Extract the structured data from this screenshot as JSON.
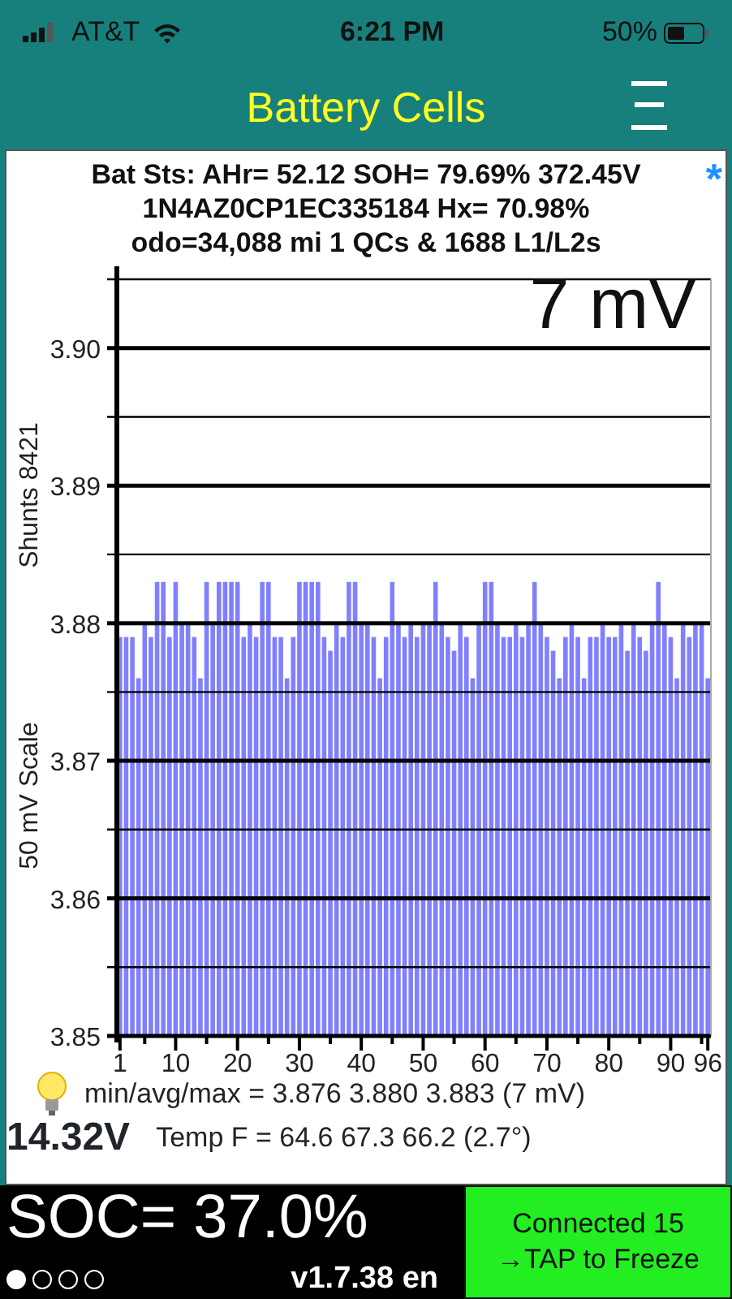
{
  "status_bar": {
    "carrier": "AT&T",
    "time": "6:21 PM",
    "battery": "50%"
  },
  "header": {
    "title": "Battery Cells"
  },
  "summary": {
    "lines": [
      "Bat Sts: AHr= 52.12 SOH= 79.69% 372.45V",
      "1N4AZ0CP1EC335184  Hx= 70.98%",
      "odo=34,088 mi 1 QCs & 1688 L1/L2s"
    ],
    "marker": "*"
  },
  "chart": {
    "spread_label": "7 mV",
    "shunts_label": "Shunts 8421",
    "chart_data": {
      "type": "bar",
      "ylabel": "50 mV Scale",
      "grid": true,
      "x": [
        1,
        2,
        3,
        4,
        5,
        6,
        7,
        8,
        9,
        10,
        11,
        12,
        13,
        14,
        15,
        16,
        17,
        18,
        19,
        20,
        21,
        22,
        23,
        24,
        25,
        26,
        27,
        28,
        29,
        30,
        31,
        32,
        33,
        34,
        35,
        36,
        37,
        38,
        39,
        40,
        41,
        42,
        43,
        44,
        45,
        46,
        47,
        48,
        49,
        50,
        51,
        52,
        53,
        54,
        55,
        56,
        57,
        58,
        59,
        60,
        61,
        62,
        63,
        64,
        65,
        66,
        67,
        68,
        69,
        70,
        71,
        72,
        73,
        74,
        75,
        76,
        77,
        78,
        79,
        80,
        81,
        82,
        83,
        84,
        85,
        86,
        87,
        88,
        89,
        90,
        91,
        92,
        93,
        94,
        95,
        96
      ],
      "series": [
        {
          "color": "#8080ff",
          "values": [
            3.879,
            3.879,
            3.879,
            3.876,
            3.88,
            3.879,
            3.883,
            3.883,
            3.879,
            3.883,
            3.88,
            3.88,
            3.879,
            3.876,
            3.883,
            3.88,
            3.883,
            3.883,
            3.883,
            3.883,
            3.879,
            3.88,
            3.879,
            3.883,
            3.883,
            3.879,
            3.879,
            3.876,
            3.879,
            3.883,
            3.883,
            3.883,
            3.883,
            3.879,
            3.878,
            3.88,
            3.879,
            3.883,
            3.883,
            3.88,
            3.88,
            3.879,
            3.876,
            3.879,
            3.883,
            3.88,
            3.879,
            3.88,
            3.879,
            3.88,
            3.88,
            3.883,
            3.88,
            3.879,
            3.878,
            3.88,
            3.879,
            3.876,
            3.88,
            3.883,
            3.883,
            3.88,
            3.879,
            3.879,
            3.88,
            3.879,
            3.88,
            3.883,
            3.88,
            3.879,
            3.878,
            3.876,
            3.879,
            3.88,
            3.879,
            3.876,
            3.879,
            3.879,
            3.88,
            3.879,
            3.879,
            3.88,
            3.878,
            3.88,
            3.879,
            3.878,
            3.88,
            3.883,
            3.88,
            3.879,
            3.876,
            3.88,
            3.879,
            3.88,
            3.88,
            3.876
          ]
        }
      ],
      "ylim": [
        3.85,
        3.905
      ],
      "yticks": [
        {
          "value": 3.85,
          "label": "3.85"
        },
        {
          "value": 3.86,
          "label": "3.86"
        },
        {
          "value": 3.87,
          "label": "3.87"
        },
        {
          "value": 3.88,
          "label": "3.88"
        },
        {
          "value": 3.89,
          "label": "3.89"
        },
        {
          "value": 3.9,
          "label": "3.90"
        }
      ],
      "xlim": [
        0.5,
        96.5
      ],
      "xticks": [
        1,
        10,
        20,
        30,
        40,
        50,
        60,
        70,
        80,
        90,
        96
      ]
    }
  },
  "stats": {
    "minavgmax": "min/avg/max = 3.876 3.880 3.883  (7 mV)",
    "voltage": "14.32V",
    "temp": "Temp F = 64.6  67.3  66.2  (2.7°)"
  },
  "footer": {
    "soc": "SOC= 37.0%",
    "pages": [
      {
        "selected": true
      },
      {
        "selected": false
      },
      {
        "selected": false
      },
      {
        "selected": false
      }
    ],
    "version": "v1.7.38 en",
    "connection": [
      "Connected 15",
      "→TAP to Freeze"
    ]
  }
}
